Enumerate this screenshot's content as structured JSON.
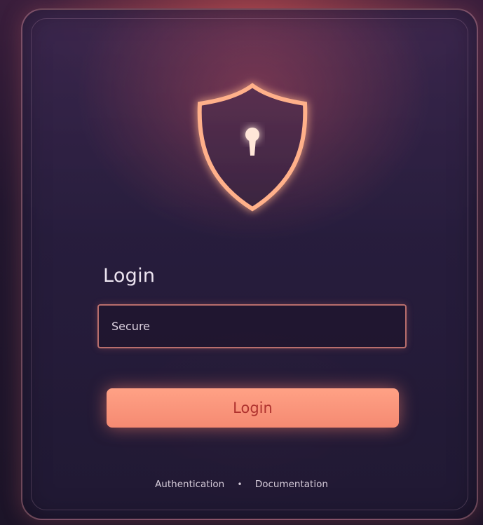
{
  "colors": {
    "accent": "#f58a72",
    "shield_glow": "#ff8a70",
    "background": "#22172f",
    "button_text": "#b0332f"
  },
  "header": {
    "shield_icon": "shield-keyhole-icon"
  },
  "form": {
    "title": "Login",
    "input_value": "Secure",
    "button_label": "Login"
  },
  "footer": {
    "left_link": "Authentication",
    "separator": "•",
    "right_link": "Documentation"
  }
}
